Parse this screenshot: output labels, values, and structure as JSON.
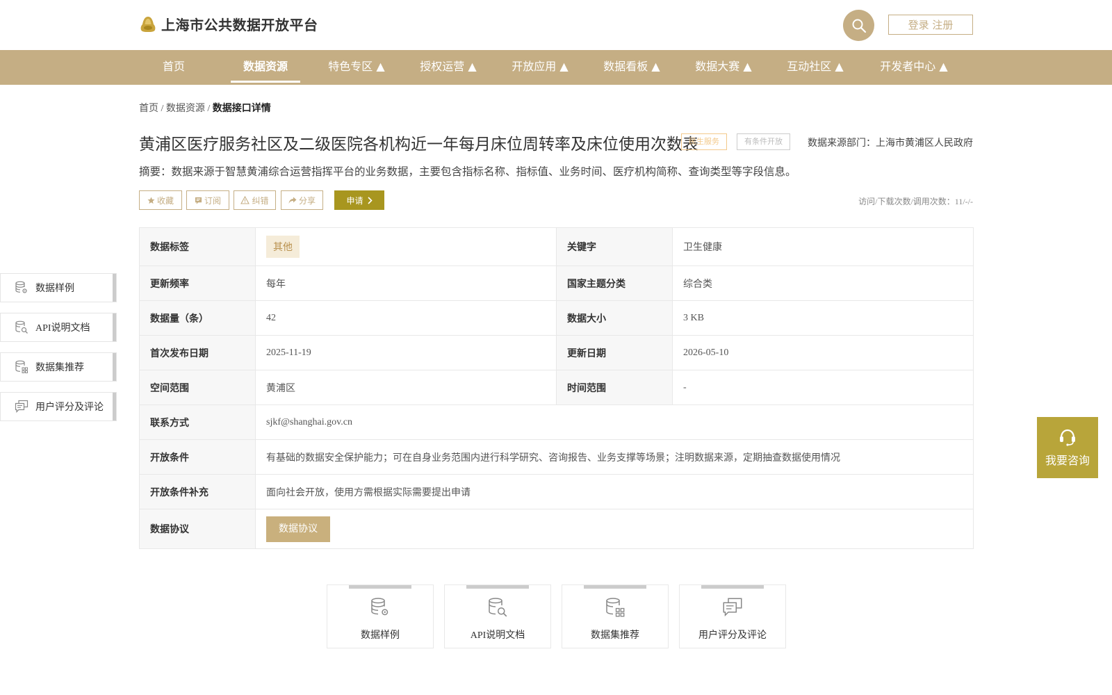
{
  "header": {
    "site_title": "上海市公共数据开放平台",
    "login_label": "登录 注册"
  },
  "nav": {
    "items": [
      {
        "label": "首页"
      },
      {
        "label": "数据资源"
      },
      {
        "label": "特色专区 ▲"
      },
      {
        "label": "授权运营 ▲"
      },
      {
        "label": "开放应用 ▲"
      },
      {
        "label": "数据看板 ▲"
      },
      {
        "label": "数据大赛 ▲"
      },
      {
        "label": "互动社区 ▲"
      },
      {
        "label": "开发者中心 ▲"
      }
    ],
    "active_index": 1
  },
  "breadcrumb": {
    "items": [
      "首页",
      "数据资源"
    ],
    "separator": " / ",
    "current": "数据接口详情"
  },
  "dataset": {
    "title": "黄浦区医疗服务社区及二级医院各机构近一年每月床位周转率及床位使用次数表",
    "tag_domain": "民生服务",
    "tag_open": "有条件开放",
    "source_dept": "数据来源部门：上海市黄浦区人民政府",
    "summary": "摘要：数据来源于智慧黄浦综合运营指挥平台的业务数据，主要包含指标名称、指标值、业务时间、医疗机构简称、查询类型等字段信息。",
    "stats": "访问/下载次数/调用次数：11/-/-"
  },
  "actions": {
    "favorite": "收藏",
    "subscribe": "订阅",
    "report": "纠错",
    "share": "分享",
    "apply": "申请"
  },
  "info": {
    "tags_label": "数据标签",
    "tags_value": "其他",
    "keyword_label": "关键字",
    "keyword_value": "卫生健康",
    "freq_label": "更新频率",
    "freq_value": "每年",
    "theme_label": "国家主题分类",
    "theme_value": "综合类",
    "count_label": "数据量（条）",
    "count_value": "42",
    "size_label": "数据大小",
    "size_value": "3 KB",
    "first_pub_label": "首次发布日期",
    "first_pub_value": "2025-11-19",
    "update_label": "更新日期",
    "update_value": "2026-05-10",
    "space_label": "空间范围",
    "space_value": "黄浦区",
    "time_label": "时间范围",
    "time_value": "-",
    "contact_label": "联系方式",
    "contact_value": "sjkf@shanghai.gov.cn",
    "condition_label": "开放条件",
    "condition_value": "有基础的数据安全保护能力；可在自身业务范围内进行科学研究、咨询报告、业务支撑等场景；注明数据来源，定期抽查数据使用情况",
    "condition_extra_label": "开放条件补充",
    "condition_extra_value": "面向社会开放，使用方需根据实际需要提出申请",
    "protocol_label": "数据协议",
    "protocol_button": "数据协议"
  },
  "side_nav": [
    {
      "label": "数据样例",
      "icon": "database-gear-icon"
    },
    {
      "label": "API说明文档",
      "icon": "database-search-icon"
    },
    {
      "label": "数据集推荐",
      "icon": "database-grid-icon"
    },
    {
      "label": "用户评分及评论",
      "icon": "comment-icon"
    }
  ],
  "consult": {
    "label": "我要咨询"
  },
  "cards": [
    {
      "label": "数据样例",
      "icon": "database-gear-icon"
    },
    {
      "label": "API说明文档",
      "icon": "database-search-icon"
    },
    {
      "label": "数据集推荐",
      "icon": "database-grid-icon"
    },
    {
      "label": "用户评分及评论",
      "icon": "comment-icon"
    }
  ],
  "colors": {
    "brand": "#c5ae84",
    "apply": "#a8961f",
    "consult": "#b8a53a"
  }
}
